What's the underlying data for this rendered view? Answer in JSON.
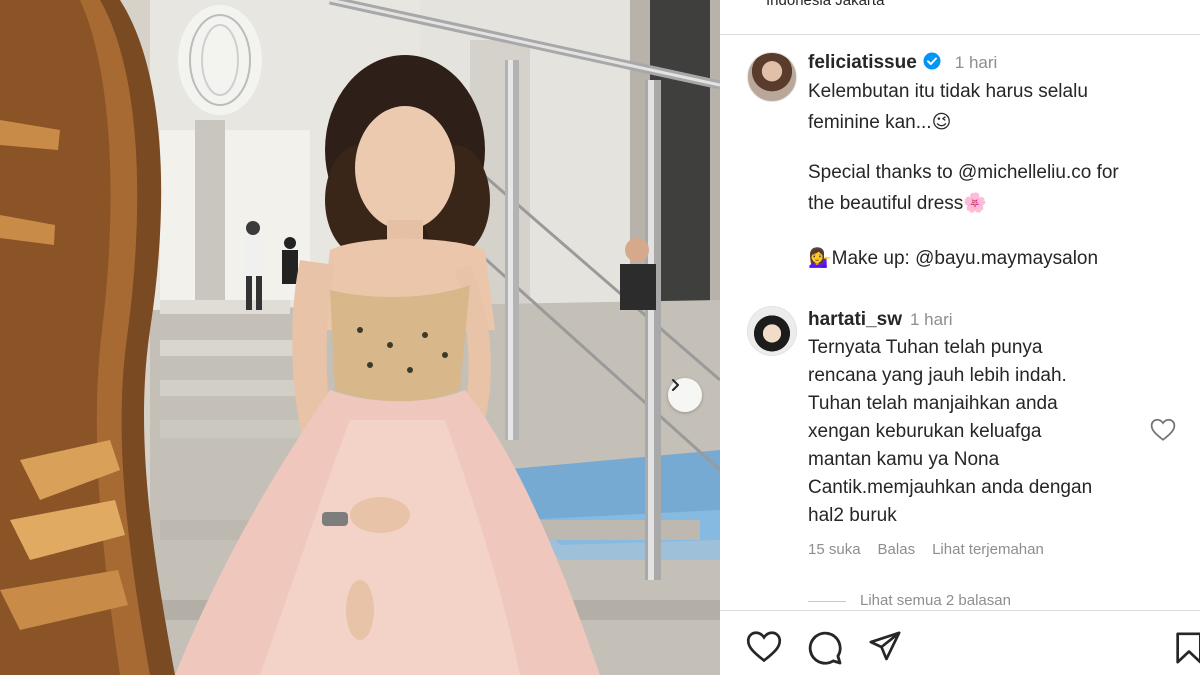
{
  "post": {
    "location": "Indonesia Jakarta"
  },
  "caption": {
    "username": "feliciatissue",
    "verified": true,
    "time": "1 hari",
    "lines": [
      "Kelembutan itu tidak harus selalu",
      "feminine kan...😉",
      "",
      "Special thanks to @michelleliu.co for",
      "the beautiful dress🌸",
      "",
      "💁‍♀️Make up: @bayu.maymaysalon"
    ]
  },
  "comment": {
    "username": "hartati_sw",
    "time": "1 hari",
    "lines": [
      "Ternyata Tuhan telah punya",
      "rencana yang jauh lebih indah.",
      "Tuhan telah manjaihkan anda",
      "xengan keburukan keluafga",
      "mantan kamu ya Nona",
      "Cantik.memjauhkan anda dengan",
      "hal2 buruk"
    ],
    "likes": "15 suka",
    "reply_label": "Balas",
    "translate_label": "Lihat terjemahan",
    "view_replies": "Lihat semua 2 balasan"
  },
  "colors": {
    "text": "#262626",
    "muted": "#8e8e8e",
    "verified": "#0095f6",
    "divider": "#dbdbdb"
  },
  "icons": {
    "like": "heart-icon",
    "comment": "comment-icon",
    "share": "send-icon",
    "save": "bookmark-icon",
    "next": "chevron-right-icon"
  }
}
